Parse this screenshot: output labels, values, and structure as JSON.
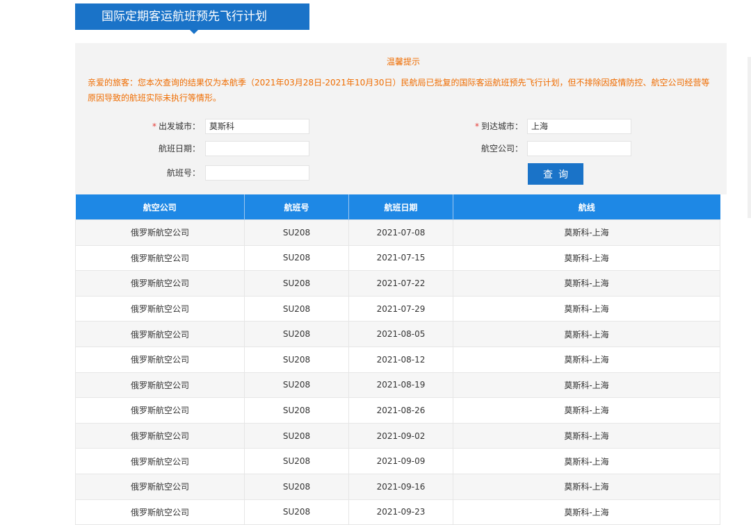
{
  "header": {
    "title": "国际定期客运航班预先飞行计划"
  },
  "notice": {
    "title": "温馨提示",
    "body": "亲爱的旅客：您本次查询的结果仅为本航季（2021年03月28日-2021年10月30日）民航局已批复的国际客运航班预先飞行计划，但不排除因疫情防控、航空公司经营等原因导致的航班实际未执行等情形。"
  },
  "form": {
    "required_mark": "*",
    "departure": {
      "label": "出发城市：",
      "value": "莫斯科"
    },
    "arrival": {
      "label": "到达城市：",
      "value": "上海"
    },
    "date": {
      "label": "航班日期：",
      "value": ""
    },
    "airline": {
      "label": "航空公司：",
      "value": ""
    },
    "flight_no": {
      "label": "航班号：",
      "value": ""
    },
    "search_label": "查询"
  },
  "table": {
    "headers": [
      "航空公司",
      "航班号",
      "航班日期",
      "航线"
    ],
    "rows": [
      [
        "俄罗斯航空公司",
        "SU208",
        "2021-07-08",
        "莫斯科-上海"
      ],
      [
        "俄罗斯航空公司",
        "SU208",
        "2021-07-15",
        "莫斯科-上海"
      ],
      [
        "俄罗斯航空公司",
        "SU208",
        "2021-07-22",
        "莫斯科-上海"
      ],
      [
        "俄罗斯航空公司",
        "SU208",
        "2021-07-29",
        "莫斯科-上海"
      ],
      [
        "俄罗斯航空公司",
        "SU208",
        "2021-08-05",
        "莫斯科-上海"
      ],
      [
        "俄罗斯航空公司",
        "SU208",
        "2021-08-12",
        "莫斯科-上海"
      ],
      [
        "俄罗斯航空公司",
        "SU208",
        "2021-08-19",
        "莫斯科-上海"
      ],
      [
        "俄罗斯航空公司",
        "SU208",
        "2021-08-26",
        "莫斯科-上海"
      ],
      [
        "俄罗斯航空公司",
        "SU208",
        "2021-09-02",
        "莫斯科-上海"
      ],
      [
        "俄罗斯航空公司",
        "SU208",
        "2021-09-09",
        "莫斯科-上海"
      ],
      [
        "俄罗斯航空公司",
        "SU208",
        "2021-09-16",
        "莫斯科-上海"
      ],
      [
        "俄罗斯航空公司",
        "SU208",
        "2021-09-23",
        "莫斯科-上海"
      ]
    ]
  },
  "colors": {
    "accent": "#1a73c8",
    "header_bg": "#1e88e5",
    "notice": "#ef6c00",
    "required": "#e53935"
  }
}
